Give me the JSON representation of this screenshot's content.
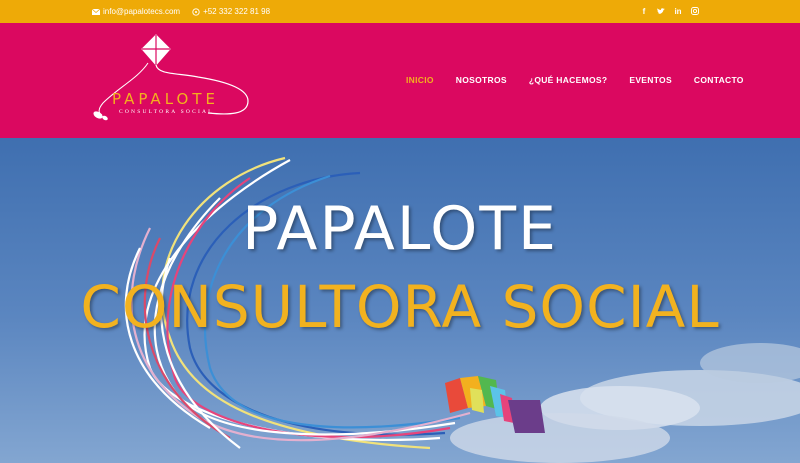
{
  "topbar": {
    "email": "info@papalotecs.com",
    "phone": "+52 332 322 81 98",
    "social": [
      {
        "icon": "facebook-icon",
        "glyph": "f"
      },
      {
        "icon": "twitter-icon",
        "glyph": "t"
      },
      {
        "icon": "linkedin-icon",
        "glyph": "in"
      },
      {
        "icon": "instagram-icon",
        "glyph": "◎"
      }
    ]
  },
  "logo": {
    "name": "PAPALOTE",
    "tagline": "CONSULTORA SOCIAL"
  },
  "nav": {
    "items": [
      {
        "label": "INICIO",
        "active": true
      },
      {
        "label": "NOSOTROS",
        "active": false
      },
      {
        "label": "¿QUÉ HACEMOS?",
        "active": false
      },
      {
        "label": "EVENTOS",
        "active": false
      },
      {
        "label": "CONTACTO",
        "active": false
      }
    ]
  },
  "hero": {
    "title": "PAPALOTE",
    "subtitle": "CONSULTORA SOCIAL"
  },
  "colors": {
    "topbar": "#eeaa07",
    "header": "#db0860",
    "accent": "#f3b01e",
    "sky": "#5b86bd"
  }
}
